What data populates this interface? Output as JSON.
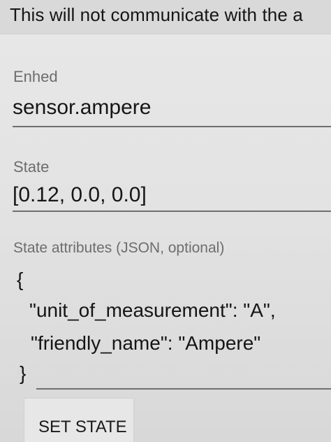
{
  "notice": {
    "text": "This will not communicate with the a"
  },
  "entity_field": {
    "label": "Enhed",
    "value": "sensor.ampere"
  },
  "state_field": {
    "label": "State",
    "value": "[0.12, 0.0, 0.0]"
  },
  "attributes_field": {
    "label": "State attributes (JSON, optional)",
    "lines": [
      "{",
      "\"unit_of_measurement\": \"A\",",
      "\"friendly_name\": \"Ampere\"",
      "}"
    ]
  },
  "actions": {
    "set_state_label": "SET STATE"
  }
}
